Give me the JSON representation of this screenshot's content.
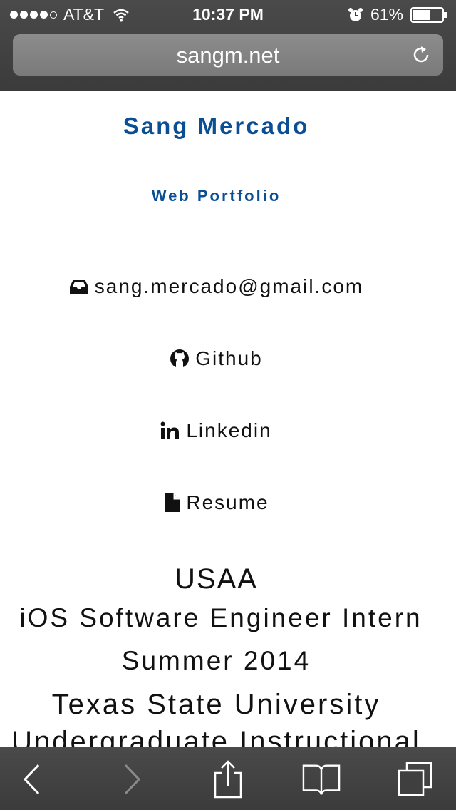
{
  "status_bar": {
    "carrier": "AT&T",
    "time": "10:37 PM",
    "battery": "61%",
    "signal_bars": 4,
    "battery_level": 0.61,
    "icons": [
      "wifi-icon",
      "alarm-icon",
      "battery-icon"
    ]
  },
  "browser": {
    "url": "sangm.net",
    "reload_icon": "reload-icon"
  },
  "page": {
    "name": "Sang Mercado",
    "subtitle": "Web Portfolio",
    "links": {
      "email": "sang.mercado@gmail.com",
      "github": "Github",
      "linkedin": "Linkedin",
      "resume": "Resume"
    },
    "experience": {
      "company": "USAA",
      "title": "iOS Software Engineer Intern",
      "date": "Summer 2014",
      "school": "Texas State University",
      "school_role": "Undergraduate Instructional"
    }
  },
  "toolbar": {
    "icons": [
      "back-icon",
      "forward-icon",
      "share-icon",
      "bookmarks-icon",
      "tabs-icon"
    ]
  }
}
